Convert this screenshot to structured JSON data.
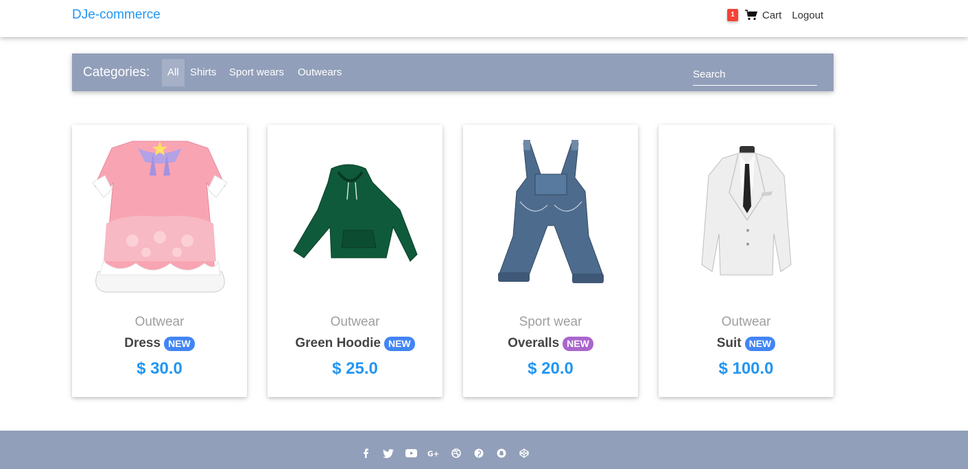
{
  "header": {
    "brand": "DJe-commerce",
    "cart_count": "1",
    "cart_label": "Cart",
    "logout_label": "Logout"
  },
  "categories": {
    "title": "Categories:",
    "items": [
      "All",
      "Shirts",
      "Sport wears",
      "Outwears"
    ],
    "active": "All",
    "search_placeholder": "Search"
  },
  "products": [
    {
      "category": "Outwear",
      "title": "Dress",
      "badge": "NEW",
      "badge_color": "#4285f4",
      "price": "$ 30.0"
    },
    {
      "category": "Outwear",
      "title": "Green Hoodie",
      "badge": "NEW",
      "badge_color": "#4285f4",
      "price": "$ 25.0"
    },
    {
      "category": "Sport wear",
      "title": "Overalls",
      "badge": "NEW",
      "badge_color": "#aa66cc",
      "price": "$ 20.0"
    },
    {
      "category": "Outwear",
      "title": "Suit",
      "badge": "NEW",
      "badge_color": "#4285f4",
      "price": "$ 100.0"
    }
  ],
  "footer": {
    "social_icons": [
      "facebook-icon",
      "twitter-icon",
      "youtube-icon",
      "google-plus-icon",
      "dribbble-icon",
      "pinterest-icon",
      "github-icon",
      "codepen-icon"
    ]
  },
  "colors": {
    "brand": "#2196f3",
    "bar": "#929fba",
    "badge_red": "#f44336"
  }
}
